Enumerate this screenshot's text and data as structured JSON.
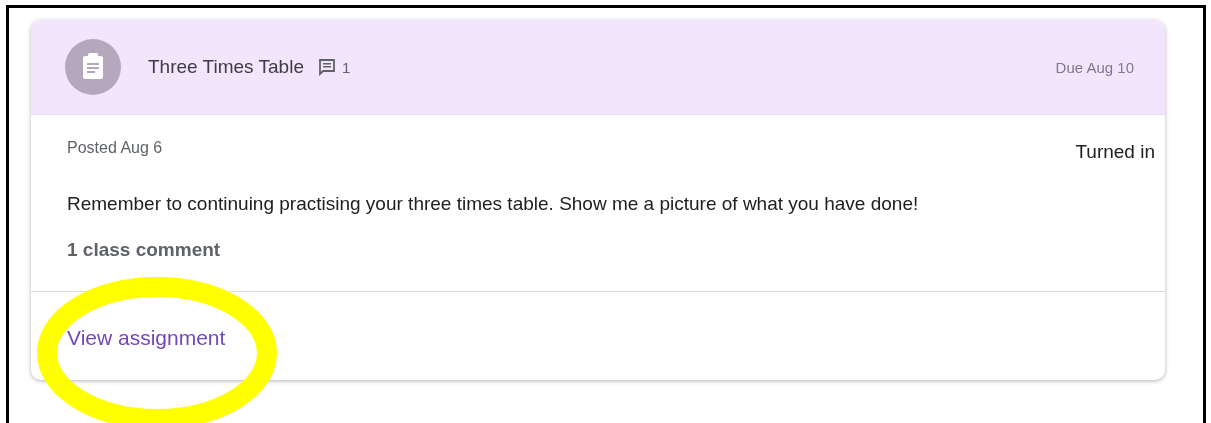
{
  "assignment": {
    "title": "Three Times Table",
    "comment_count": "1",
    "due": "Due Aug 10",
    "posted": "Posted Aug 6",
    "status": "Turned in",
    "description": "Remember to continuing practising your three times table. Show me a picture of what you have done!",
    "class_comments": "1 class comment",
    "link": "View assignment"
  }
}
